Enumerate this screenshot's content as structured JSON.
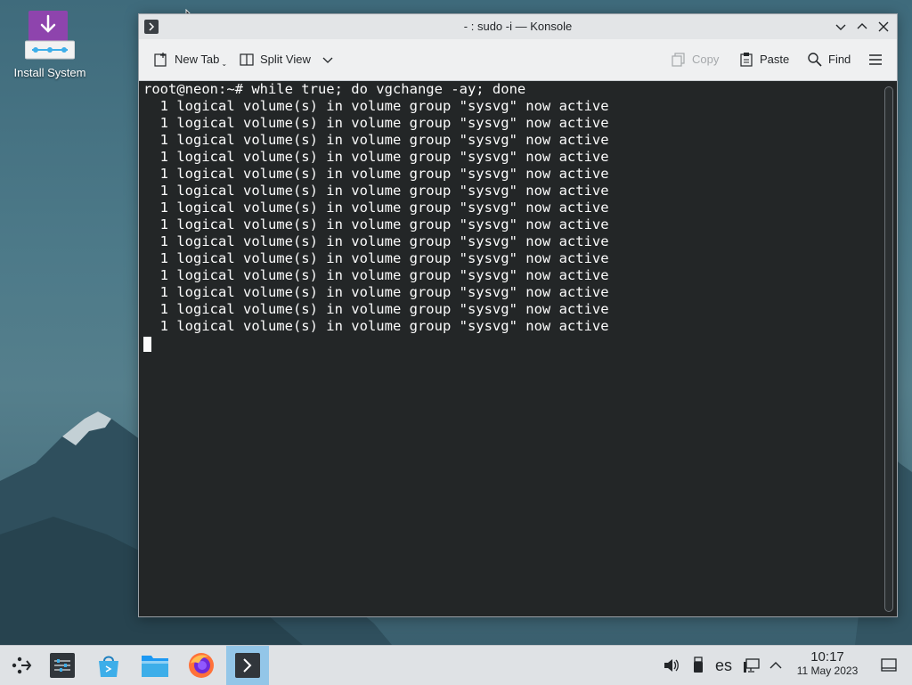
{
  "desktop": {
    "icons": [
      {
        "label": "Install System",
        "icon": "install-system-icon"
      }
    ]
  },
  "window": {
    "title": "- : sudo -i — Konsole",
    "toolbar": {
      "new_tab": "New Tab",
      "split_view": "Split View",
      "copy": "Copy",
      "paste": "Paste",
      "find": "Find"
    },
    "terminal": {
      "lines": [
        "root@neon:~# while true; do vgchange -ay; done",
        "  1 logical volume(s) in volume group \"sysvg\" now active",
        "  1 logical volume(s) in volume group \"sysvg\" now active",
        "  1 logical volume(s) in volume group \"sysvg\" now active",
        "  1 logical volume(s) in volume group \"sysvg\" now active",
        "  1 logical volume(s) in volume group \"sysvg\" now active",
        "  1 logical volume(s) in volume group \"sysvg\" now active",
        "  1 logical volume(s) in volume group \"sysvg\" now active",
        "  1 logical volume(s) in volume group \"sysvg\" now active",
        "  1 logical volume(s) in volume group \"sysvg\" now active",
        "  1 logical volume(s) in volume group \"sysvg\" now active",
        "  1 logical volume(s) in volume group \"sysvg\" now active",
        "  1 logical volume(s) in volume group \"sysvg\" now active",
        "  1 logical volume(s) in volume group \"sysvg\" now active",
        "  1 logical volume(s) in volume group \"sysvg\" now active"
      ]
    }
  },
  "taskbar": {
    "apps": [
      "application-launcher-icon",
      "system-settings-icon",
      "discover-store-icon",
      "file-manager-icon",
      "firefox-icon",
      "konsole-icon"
    ],
    "tray": {
      "language": "es",
      "time": "10:17",
      "date": "11 May 2023"
    }
  },
  "colors": {
    "terminal_bg": "#232627",
    "terminal_fg": "#fcfcfc",
    "active_task": "#93c6e8",
    "taskbar_bg": "#dfe2e5"
  }
}
